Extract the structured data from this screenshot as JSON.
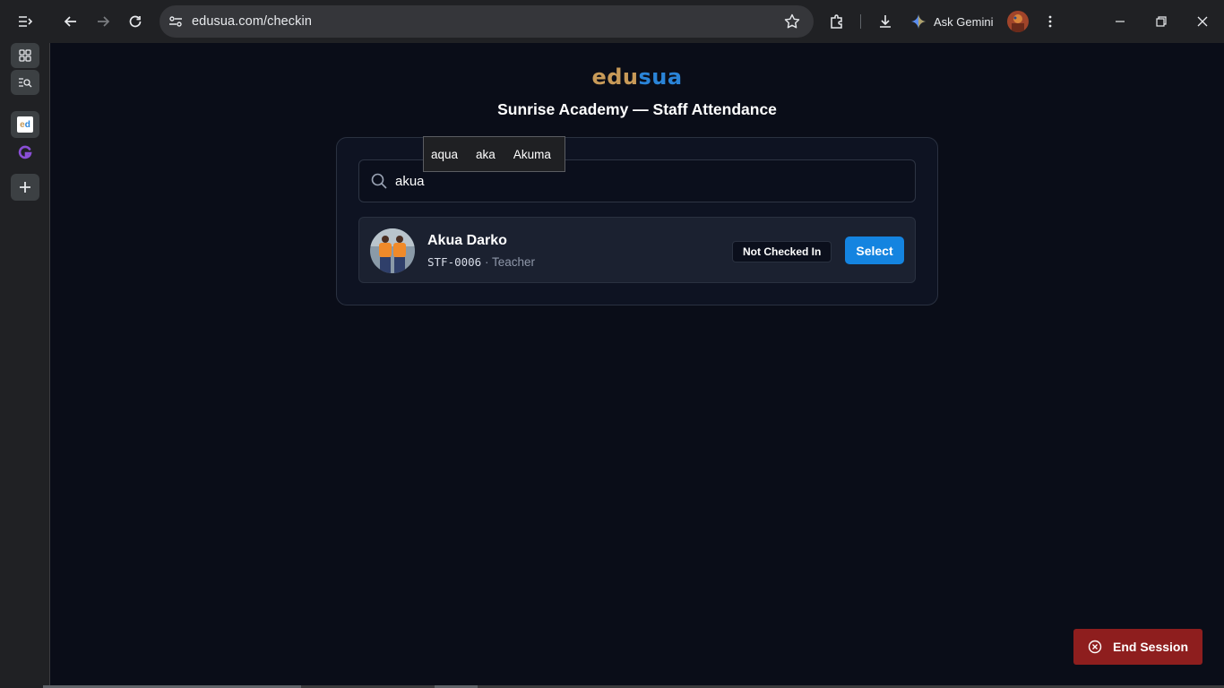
{
  "browser": {
    "url": "edusua.com/checkin",
    "gemini_label": "Ask Gemini"
  },
  "sidebar": {
    "items": [
      {
        "icon": "tab-grid-icon"
      },
      {
        "icon": "tab-search-icon"
      },
      {
        "icon": "edusua-favicon"
      },
      {
        "icon": "grammarly-g-icon"
      },
      {
        "icon": "add-icon"
      }
    ]
  },
  "page": {
    "logo_part1": "edu",
    "logo_part2": "sua",
    "title": "Sunrise Academy — Staff Attendance"
  },
  "search": {
    "value": "akua",
    "suggestions": [
      "aqua",
      "aka",
      "Akuma"
    ]
  },
  "results": [
    {
      "name": "Akua Darko",
      "staff_id": "STF-0006",
      "separator": " · ",
      "role": "Teacher",
      "status": "Not Checked In",
      "action": "Select"
    }
  ],
  "footer": {
    "end_session_label": "End Session"
  },
  "colors": {
    "accent": "#1484e0",
    "danger": "#8e1e1e",
    "logo_primary": "#c89a58",
    "logo_secondary": "#2a84d8"
  }
}
